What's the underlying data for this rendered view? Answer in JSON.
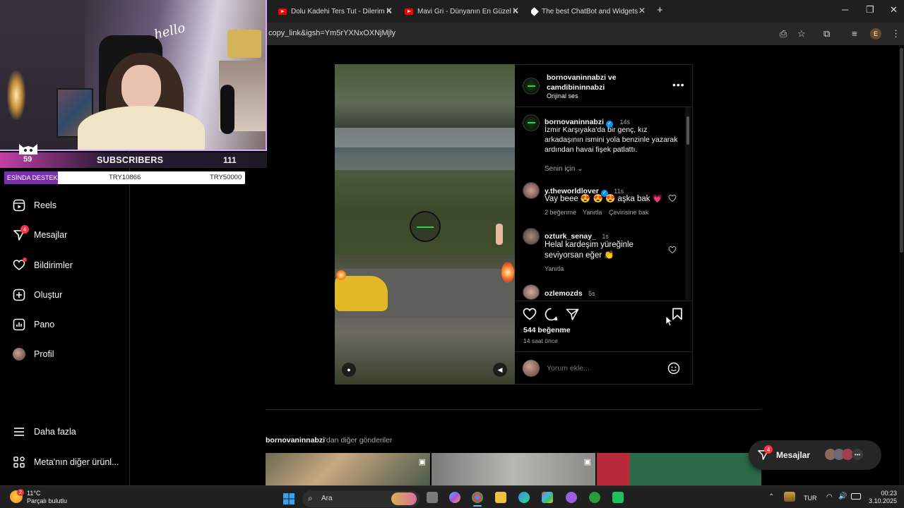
{
  "browser": {
    "tabs": [
      {
        "title": "Dolu Kadehi Ters Tut - Dilerim K",
        "icon": "youtube-icon"
      },
      {
        "title": "Mavi Gri - Dünyanın En Güzel K",
        "icon": "youtube-icon"
      },
      {
        "title": "The best ChatBot and Widgets",
        "icon": "chatbot-icon"
      }
    ],
    "new_tab": "+",
    "url": "copy_link&igsh=Ym5rYXNxOXNjMjly",
    "profile_initial": "E"
  },
  "overlay": {
    "left_count": "59",
    "subscribers_label": "SUBSCRIBERS",
    "right_count": "111",
    "hello": "hello",
    "donate_left": "ESİNDA DESTEK",
    "donate_mid": "TRY10866",
    "donate_right": "TRY50000"
  },
  "sidebar": {
    "items": [
      {
        "label": "Reels",
        "icon": "reels-icon"
      },
      {
        "label": "Mesajlar",
        "icon": "messenger-icon",
        "badge": "4"
      },
      {
        "label": "Bildirimler",
        "icon": "heart-icon"
      },
      {
        "label": "Oluştur",
        "icon": "plus-square-icon"
      },
      {
        "label": "Pano",
        "icon": "chart-icon"
      },
      {
        "label": "Profil",
        "icon": "profile-avatar"
      }
    ],
    "more": "Daha fazla",
    "meta": "Meta'nın diğer ürünl..."
  },
  "post": {
    "header": {
      "line1": "bornovaninnabzi ve",
      "line2": "camdibininnabzi",
      "audio": "Orijinal ses"
    },
    "caption": {
      "user": "bornovaninnabzi",
      "time": "14s",
      "text": "İzmir  Karşıyaka'da bir genç, kız arkadaşının ismini yola benzinle yazarak ardından havai fişek patlattı."
    },
    "for_you": "Senin için",
    "comments": [
      {
        "user": "y.theworldlover",
        "time": "11s",
        "text": "Vay beee 😍 😍 😍 aşka bak 💗",
        "likes": "2 beğenme",
        "reply": "Yanıtla",
        "translate": "Çevirisine bak"
      },
      {
        "user": "ozturk_senay_",
        "time": "1s",
        "text": "Helal kardeşim yüreğinle seviyorsan eğer 👏",
        "reply": "Yanıtla"
      },
      {
        "user": "ozlemozds",
        "time": "5s",
        "text": ""
      }
    ],
    "likes": "544 beğenme",
    "time_ago": "14 saat önce",
    "comment_placeholder": "Yorum ekle..."
  },
  "more_posts": {
    "user": "bornovaninnabzi",
    "suffix": "'dan diğer gönderiler"
  },
  "messages_pill": {
    "label": "Mesajlar",
    "badge": "4"
  },
  "taskbar": {
    "temp": "11°C",
    "weather": "Parçalı bulutlu",
    "weather_badge": "2",
    "search": "Ara",
    "lang": "TUR",
    "time": "00:23",
    "date": "3.10.2025"
  }
}
